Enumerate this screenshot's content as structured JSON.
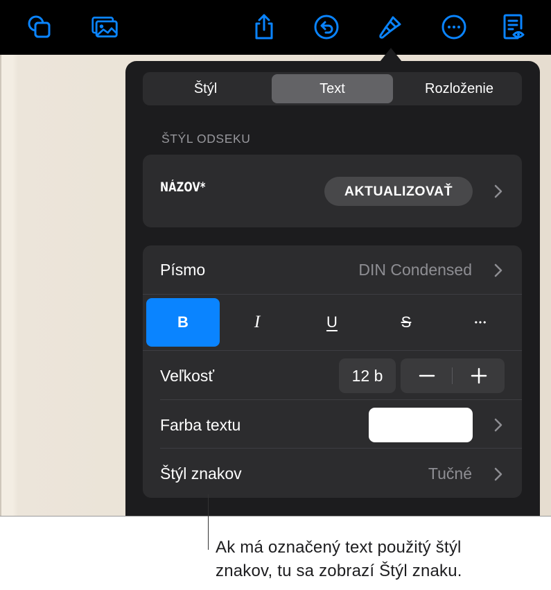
{
  "toolbar": {
    "items": [
      {
        "icon": "shapes-icon"
      },
      {
        "icon": "media-icon"
      },
      {
        "icon": "share-icon"
      },
      {
        "icon": "undo-icon"
      },
      {
        "icon": "format-brush-icon"
      },
      {
        "icon": "more-icon"
      },
      {
        "icon": "reading-view-icon"
      }
    ],
    "accent_color": "#0a84ff"
  },
  "popover": {
    "tabs": [
      {
        "label": "Štýl",
        "active": false
      },
      {
        "label": "Text",
        "active": true
      },
      {
        "label": "Rozloženie",
        "active": false
      }
    ],
    "paragraph_style": {
      "header": "ŠTÝL ODSEKU",
      "name": "NÁZOV*",
      "update_label": "AKTUALIZOVAŤ"
    },
    "font": {
      "label": "Písmo",
      "value": "DIN Condensed"
    },
    "format_buttons": {
      "bold": "B",
      "italic": "I",
      "underline": "U",
      "strikethrough": "S",
      "more": "•••",
      "active": "bold"
    },
    "size": {
      "label": "Veľkosť",
      "value": "12 b"
    },
    "text_color": {
      "label": "Farba textu",
      "swatch": "#ffffff"
    },
    "character_style": {
      "label": "Štýl znakov",
      "value": "Tučné"
    }
  },
  "callout": {
    "line1": "Ak má označený text použitý štýl",
    "line2": "znakov, tu sa zobrazí Štýl znaku."
  }
}
